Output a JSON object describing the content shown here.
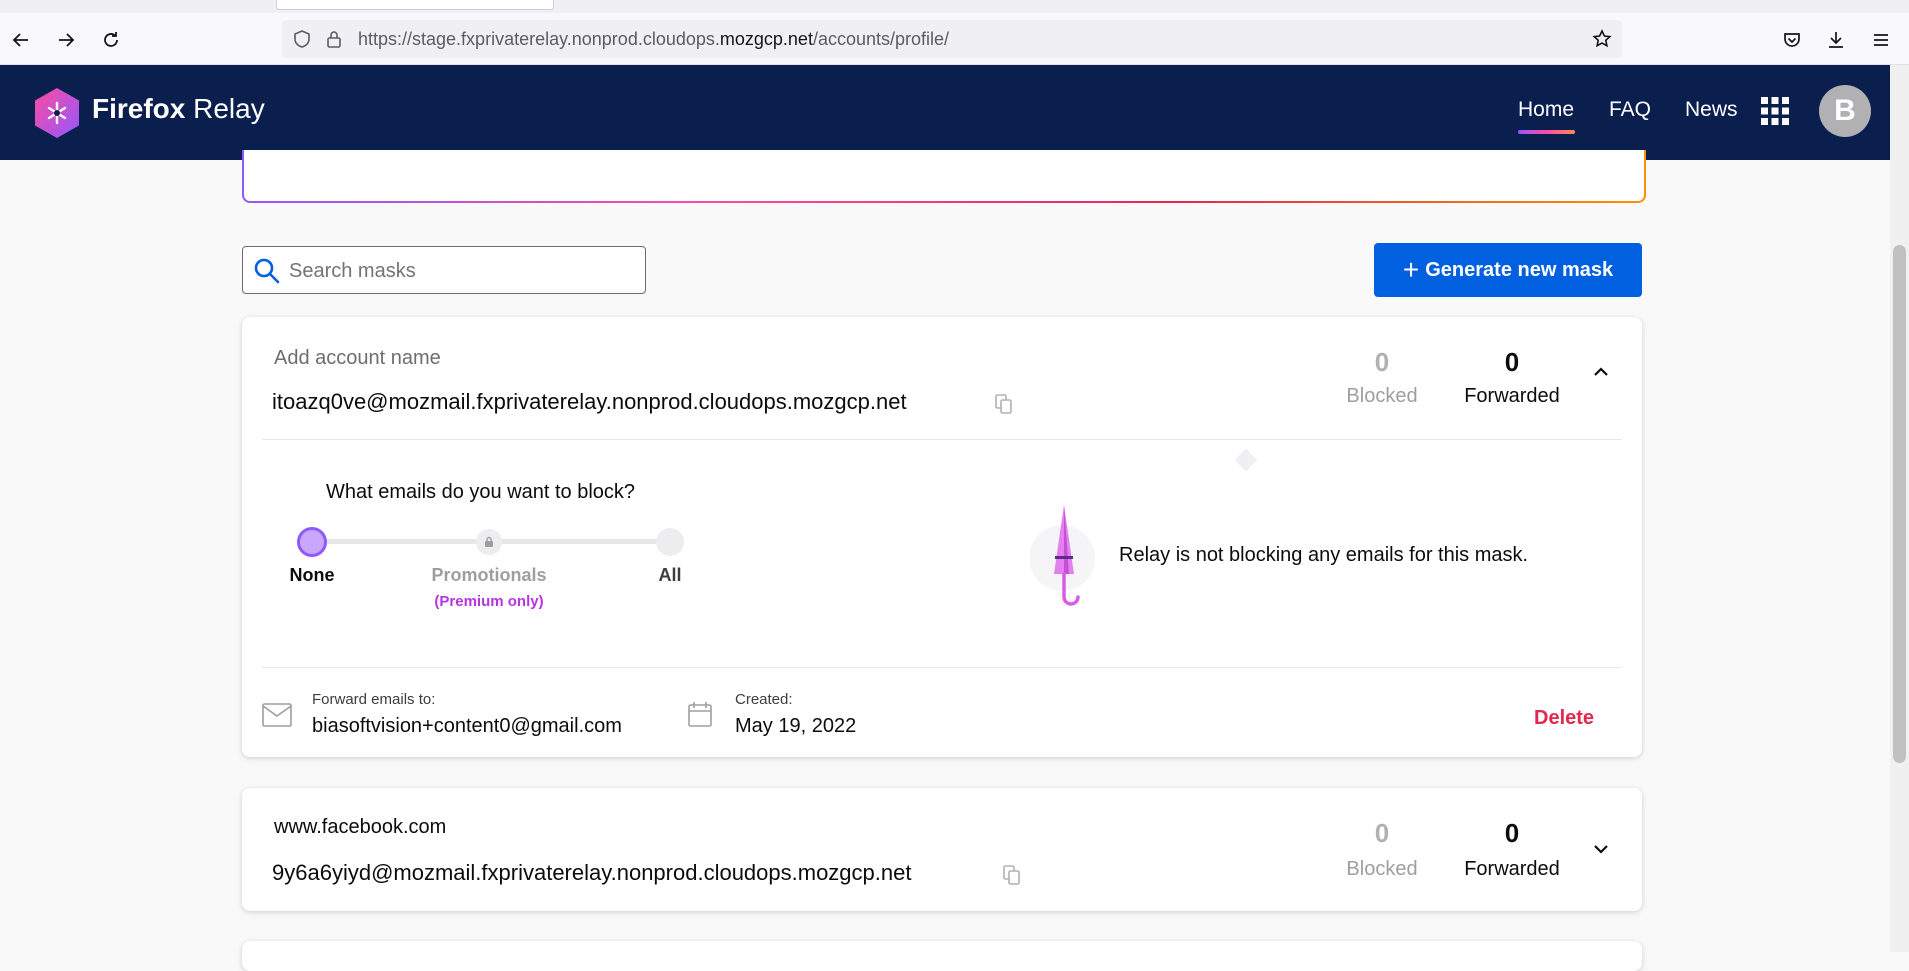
{
  "browser": {
    "url_prefix": "https://stage.fxprivaterelay.nonprod.cloudops.",
    "url_domain": "mozgcp.net",
    "url_suffix": "/accounts/profile/"
  },
  "header": {
    "logo_bold": "Firefox",
    "logo_light": " Relay",
    "nav": {
      "home": "Home",
      "faq": "FAQ",
      "news": "News"
    },
    "avatar_initial": "B"
  },
  "toolbar": {
    "search_placeholder": "Search masks",
    "generate_label": "Generate new mask",
    "generate_icon": "+"
  },
  "masks": [
    {
      "name": "Add account name",
      "address": "itoazq0ve@mozmail.fxprivaterelay.nonprod.cloudops.mozgcp.net",
      "blocked_count": "0",
      "blocked_label": "Blocked",
      "forwarded_count": "0",
      "forwarded_label": "Forwarded",
      "expanded": true,
      "block_question": "What emails do you want to block?",
      "block_levels": {
        "none": "None",
        "promotionals": "Promotionals",
        "promotionals_note": "(Premium only)",
        "all": "All"
      },
      "block_status": "Relay is not blocking any emails for this mask.",
      "forward_label": "Forward emails to:",
      "forward_value": "biasoftvision+content0@gmail.com",
      "created_label": "Created:",
      "created_value": "May 19, 2022",
      "delete_label": "Delete"
    },
    {
      "name": "www.facebook.com",
      "address": "9y6a6yiyd@mozmail.fxprivaterelay.nonprod.cloudops.mozgcp.net",
      "blocked_count": "0",
      "blocked_label": "Blocked",
      "forwarded_count": "0",
      "forwarded_label": "Forwarded",
      "expanded": false
    }
  ],
  "colors": {
    "header_bg": "#0b1f4f",
    "primary_button": "#0060df",
    "delete_text": "#e22850",
    "premium_text": "#b833e1",
    "slider_active": "#9059ff"
  }
}
